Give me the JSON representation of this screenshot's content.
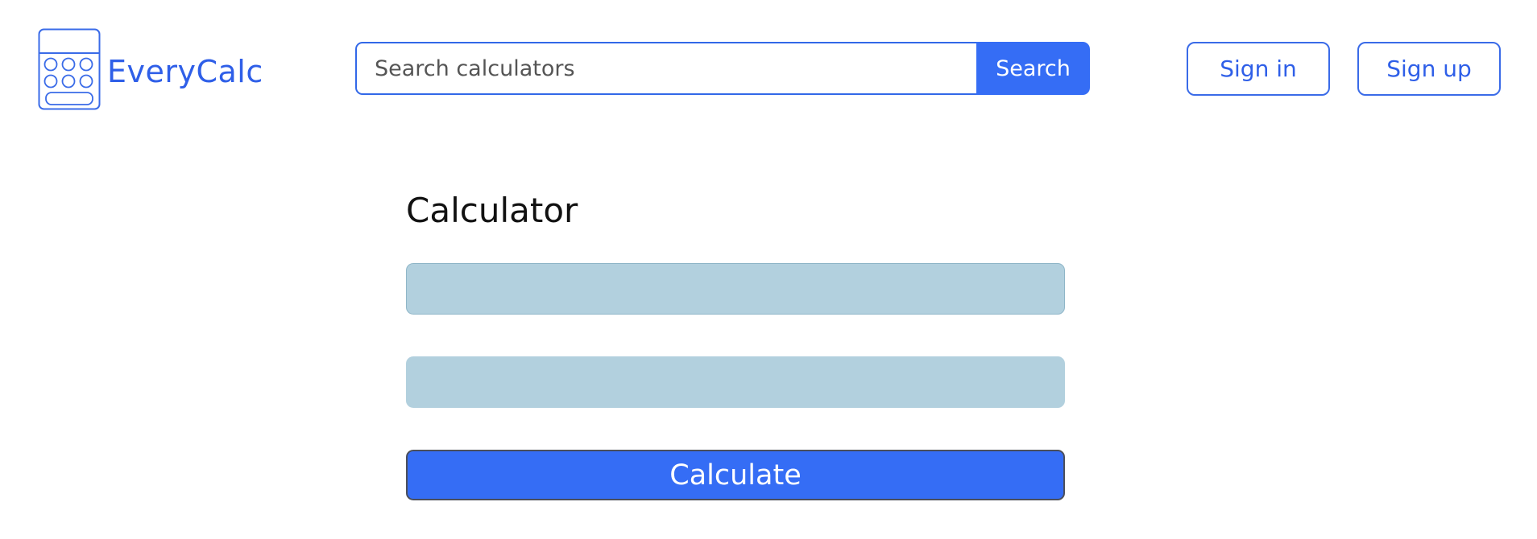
{
  "header": {
    "logo_text": "EveryCalc",
    "logo_icon": "calculator-icon",
    "search": {
      "placeholder": "Search calculators",
      "value": "",
      "button_label": "Search"
    },
    "sign_in_label": "Sign in",
    "sign_up_label": "Sign up"
  },
  "main": {
    "title": "Calculator",
    "input_1": {
      "value": "",
      "placeholder": ""
    },
    "input_2": {
      "value": "",
      "placeholder": ""
    },
    "calculate_label": "Calculate"
  },
  "colors": {
    "accent": "#356df5",
    "brand_text": "#2f5fe8",
    "input_bg": "#b2d0de",
    "button_border": "#4b4f5c"
  }
}
